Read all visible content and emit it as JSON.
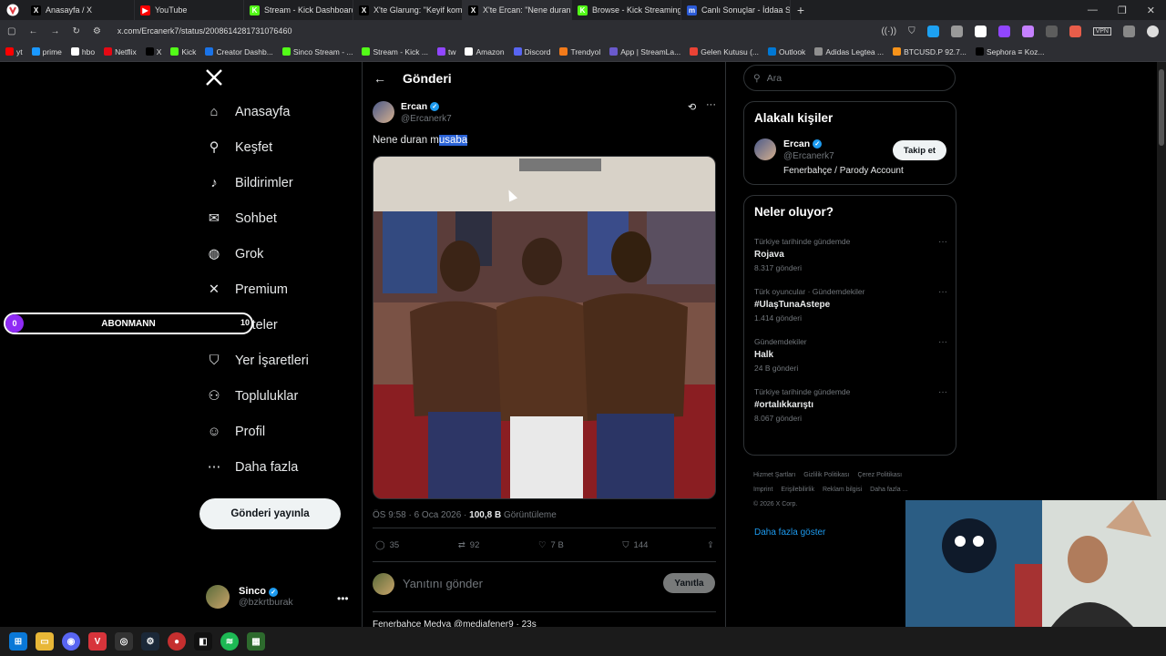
{
  "browser": {
    "tabs": [
      {
        "label": "Anasayfa / X",
        "fav": "X",
        "color": "#000000"
      },
      {
        "label": "YouTube",
        "fav": "▶",
        "color": "#ff0000"
      },
      {
        "label": "Stream - Kick Dashboard",
        "fav": "K",
        "color": "#53fc18"
      },
      {
        "label": "X'te Glarung: \"Keyif komas",
        "fav": "X",
        "color": "#000000"
      },
      {
        "label": "X'te Ercan: \"Nene duran m",
        "fav": "X",
        "color": "#000000"
      },
      {
        "label": "Browse - Kick Streaming",
        "fav": "K",
        "color": "#53fc18"
      },
      {
        "label": "Canlı Sonuçlar - İddaa Son",
        "fav": "m",
        "color": "#2b5bd7"
      }
    ],
    "new_tab": "+",
    "url": "x.com/Ercanerk7/status/2008614281731076460",
    "vpn_label": "VPN",
    "bookmarks": [
      {
        "label": "yt",
        "color": "#ff0000"
      },
      {
        "label": "prime",
        "color": "#1a98ff"
      },
      {
        "label": "hbo",
        "color": "#ffffff"
      },
      {
        "label": "Netflix",
        "color": "#e50914"
      },
      {
        "label": "X",
        "color": "#000000"
      },
      {
        "label": "Kick",
        "color": "#53fc18"
      },
      {
        "label": "Creator Dashb...",
        "color": "#1a73e8"
      },
      {
        "label": "Sinco Stream - ...",
        "color": "#53fc18"
      },
      {
        "label": "Stream - Kick ...",
        "color": "#53fc18"
      },
      {
        "label": "tw",
        "color": "#9146ff"
      },
      {
        "label": "Amazon",
        "color": "#ffffff"
      },
      {
        "label": "Discord",
        "color": "#5865f2"
      },
      {
        "label": "Trendyol",
        "color": "#f27a1a"
      },
      {
        "label": "App | StreamLa...",
        "color": "#6a5acd"
      },
      {
        "label": "Gelen Kutusu (...",
        "color": "#ea4335"
      },
      {
        "label": "Outlook",
        "color": "#0078d4"
      },
      {
        "label": "Adidas Legtea ...",
        "color": "#8f8f8f"
      },
      {
        "label": "BTCUSD.P 92.7...",
        "color": "#f7931a"
      },
      {
        "label": "Sephora ≡ Koz...",
        "color": "#000000"
      }
    ]
  },
  "nav": {
    "items": [
      {
        "label": "Anasayfa",
        "icon": "home-icon",
        "glyph": "⌂"
      },
      {
        "label": "Keşfet",
        "icon": "search-icon",
        "glyph": "⚲"
      },
      {
        "label": "Bildirimler",
        "icon": "bell-icon",
        "glyph": "♪"
      },
      {
        "label": "Sohbet",
        "icon": "mail-icon",
        "glyph": "✉"
      },
      {
        "label": "Grok",
        "icon": "grok-icon",
        "glyph": "◍"
      },
      {
        "label": "Premium",
        "icon": "x-premium-icon",
        "glyph": "✕"
      },
      {
        "label": "Listeler",
        "icon": "list-icon",
        "glyph": "☰"
      },
      {
        "label": "Yer İşaretleri",
        "icon": "bookmark-icon",
        "glyph": "⛉"
      },
      {
        "label": "Topluluklar",
        "icon": "communities-icon",
        "glyph": "⚇"
      },
      {
        "label": "Profil",
        "icon": "profile-icon",
        "glyph": "☺"
      },
      {
        "label": "Daha fazla",
        "icon": "more-icon",
        "glyph": "⋯"
      }
    ],
    "post_button": "Gönderi yayınla",
    "account": {
      "name": "Sinco",
      "handle": "@bzkrtburak"
    }
  },
  "overlay": {
    "count": "0",
    "label": "ABONMANN",
    "goal": "10"
  },
  "main": {
    "header": "Gönderi",
    "tweet": {
      "name": "Ercan",
      "handle": "@Ercanerk7",
      "text_plain": "Nene duran m",
      "text_highlight": "usaba",
      "time": "ÖS 9:58 · 6 Oca 2026 · ",
      "views": "100,8 B",
      "views_label": " Görüntüleme",
      "replies": "35",
      "reposts": "92",
      "likes": "7 B",
      "bookmarks": "144"
    },
    "reply_placeholder": "Yanıtını gönder",
    "reply_button": "Yanıtla",
    "next_tweet": "Fenerbahçe Medya  @mediafener9 · 23s"
  },
  "right": {
    "search_placeholder": "Ara",
    "related_title": "Alakalı kişiler",
    "related": {
      "name": "Ercan",
      "handle": "@Ercanerk7",
      "bio": "Fenerbahçe / Parody Account",
      "follow": "Takip et"
    },
    "trends_title": "Neler oluyor?",
    "trends": [
      {
        "context": "Türkiye tarihinde gündemde",
        "name": "Rojava",
        "count": "8.317 gönderi"
      },
      {
        "context": "Türk oyuncular · Gündemdekiler",
        "name": "#UlaşTunaAstepe",
        "count": "1.414 gönderi"
      },
      {
        "context": "Gündemdekiler",
        "name": "Halk",
        "count": "24 B gönderi"
      },
      {
        "context": "Türkiye tarihinde gündemde",
        "name": "#ortalıkkarıştı",
        "count": "8.067 gönderi"
      }
    ],
    "show_more": "Daha fazla göster",
    "footer": [
      "Hizmet Şartları",
      "Gizlilik Politikası",
      "Çerez Politikası",
      "Imprint",
      "Erişilebilirlik",
      "Reklam bilgisi",
      "Daha fazla ...",
      "© 2026 X Corp."
    ]
  }
}
